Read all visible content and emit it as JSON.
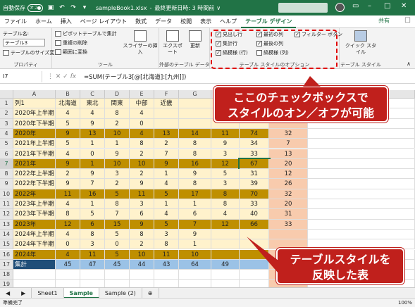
{
  "titlebar": {
    "autosave": "自動保存",
    "toggle": "オフ",
    "filename": "sampleBook1.xlsx",
    "saved": "最終更新日時: 3 時間前",
    "dropdown": "∨"
  },
  "tabs": [
    "ファイル",
    "ホーム",
    "挿入",
    "ページ レイアウト",
    "数式",
    "データ",
    "校閲",
    "表示",
    "ヘルプ",
    "テーブル デザイン"
  ],
  "share": "共有",
  "ribbon": {
    "props": {
      "name_label": "テーブル名:",
      "name_value": "テーブル3",
      "resize": "テーブルのサイズ変更",
      "label": "プロパティ"
    },
    "tools": {
      "pivot": "ピボットテーブルで集計",
      "dedupe": "重複の削除",
      "range": "範囲に変換",
      "slicer": "スライサーの挿入",
      "label": "ツール"
    },
    "external": {
      "export": "エクスポート",
      "refresh": "更新",
      "label": "外部のテーブル データ"
    },
    "options": {
      "header": "見出し行",
      "total": "集計行",
      "banded_rows": "縞模様 (行)",
      "first_col": "最初の列",
      "last_col": "最後の列",
      "banded_cols": "縞模様 (列)",
      "filter": "フィルター ボタン",
      "label": "テーブル スタイルのオプション"
    },
    "styles": {
      "quick": "クイック スタイル",
      "label": "テーブル スタイル"
    }
  },
  "formula": {
    "namebox": "I7",
    "fx": "fx",
    "content": "=SUM(テーブル3[@[北海道]:[九州]])"
  },
  "columns": [
    "A",
    "B",
    "C",
    "D",
    "E",
    "F",
    "G",
    "H",
    "I",
    "J"
  ],
  "header_row": [
    "列1",
    "北海道",
    "東北",
    "関東",
    "中部",
    "近畿",
    "",
    "",
    "",
    ""
  ],
  "rows": [
    [
      "2020年上半期",
      "4",
      "4",
      "8",
      "4",
      "",
      "",
      "",
      "",
      ""
    ],
    [
      "2020年下半期",
      "5",
      "9",
      "2",
      "0",
      "",
      "",
      "",
      "",
      ""
    ],
    [
      "2020年",
      "9",
      "13",
      "10",
      "4",
      "13",
      "14",
      "11",
      "74",
      "32"
    ],
    [
      "2021年上半期",
      "5",
      "1",
      "1",
      "8",
      "2",
      "8",
      "9",
      "34",
      "7"
    ],
    [
      "2021年下半期",
      "4",
      "0",
      "9",
      "2",
      "7",
      "8",
      "3",
      "33",
      "13"
    ],
    [
      "2021年",
      "9",
      "1",
      "10",
      "10",
      "9",
      "16",
      "12",
      "67",
      "20"
    ],
    [
      "2022年上半期",
      "2",
      "9",
      "3",
      "2",
      "1",
      "9",
      "5",
      "31",
      "12"
    ],
    [
      "2022年下半期",
      "9",
      "7",
      "2",
      "9",
      "4",
      "8",
      "3",
      "39",
      "26"
    ],
    [
      "2022年",
      "11",
      "16",
      "5",
      "11",
      "5",
      "17",
      "8",
      "70",
      "32"
    ],
    [
      "2023年上半期",
      "4",
      "1",
      "8",
      "3",
      "1",
      "1",
      "8",
      "33",
      "20"
    ],
    [
      "2023年下半期",
      "8",
      "5",
      "7",
      "6",
      "4",
      "6",
      "4",
      "40",
      "31"
    ],
    [
      "2023年",
      "12",
      "6",
      "15",
      "9",
      "5",
      "7",
      "12",
      "66",
      "33"
    ],
    [
      "2024年上半期",
      "4",
      "8",
      "5",
      "8",
      "3",
      "9",
      "",
      "",
      ""
    ],
    [
      "2024年下半期",
      "0",
      "3",
      "0",
      "2",
      "8",
      "1",
      "",
      "",
      ""
    ],
    [
      "2024年",
      "4",
      "11",
      "5",
      "10",
      "11",
      "10",
      "",
      "",
      ""
    ],
    [
      "集計",
      "45",
      "47",
      "45",
      "44",
      "43",
      "64",
      "49",
      "",
      ""
    ]
  ],
  "sheets": [
    "Sheet1",
    "Sample",
    "Sample (2)"
  ],
  "status": {
    "ready": "準備完了",
    "zoom": "100%"
  },
  "callouts": {
    "c1_line1": "ここのチェックボックスで",
    "c1_line2": "スタイルのオン／オフが可能",
    "c2_line1": "テーブルスタイルを",
    "c2_line2": "反映した表"
  },
  "colors": {
    "excel_green": "#217346",
    "band_dark": "#bf8f00",
    "band_light": "#fff2cc",
    "total": "#9bc2e6",
    "total_label": "#1f4e78",
    "salmon": "#f4b183",
    "callout": "#c0201c"
  }
}
